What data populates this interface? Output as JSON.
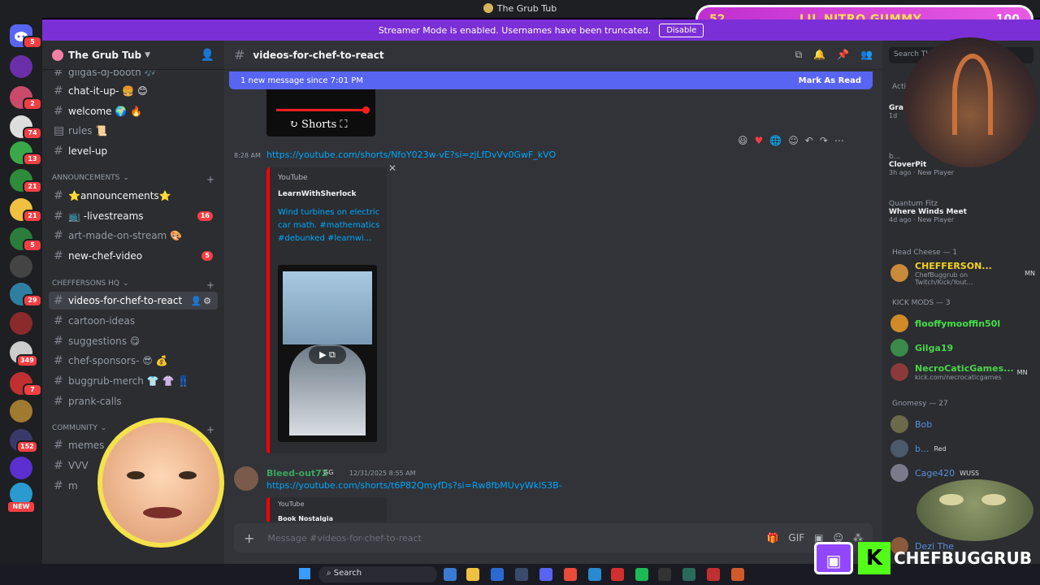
{
  "window": {
    "title": "The Grub Tub"
  },
  "streamer_banner": {
    "text": "Streamer Mode is enabled. Usernames have been truncated.",
    "button": "Disable"
  },
  "nitro_bar": {
    "left": "52",
    "title": "LIL NITRO GUMMY",
    "right": "100"
  },
  "rail": {
    "badges": [
      "5",
      "2",
      "74",
      "13",
      "21",
      "21",
      "5",
      "29",
      "349",
      "7",
      "152"
    ],
    "new_label": "NEW"
  },
  "server": {
    "name": "The Grub Tub"
  },
  "channels": {
    "top": [
      {
        "name": "gilgas-dj-booth 🎶",
        "unread": false
      },
      {
        "name": "chat-it-up- 🍔 😊",
        "unread": true
      },
      {
        "name": "welcome 🌍 🔥",
        "unread": true
      },
      {
        "name": "rules 📜",
        "unread": false
      },
      {
        "name": "level-up",
        "unread": true
      }
    ],
    "announcements_label": "Announcements",
    "announcements": [
      {
        "name": "⭐announcements⭐",
        "unread": true,
        "count": ""
      },
      {
        "name": "📺 -livestreams",
        "unread": true,
        "count": "16"
      },
      {
        "name": "art-made-on-stream 🎨",
        "unread": false,
        "count": ""
      },
      {
        "name": "new-chef-video",
        "unread": true,
        "count": "5"
      }
    ],
    "hq_label": "CHEFFERSONS HQ",
    "hq": [
      {
        "name": "videos-for-chef-to-react"
      },
      {
        "name": "cartoon-ideas"
      },
      {
        "name": "suggestions 😋"
      },
      {
        "name": "chef-sponsors- 😎 💰"
      },
      {
        "name": "buggrub-merch 👕 👚 👖"
      },
      {
        "name": "prank-calls"
      }
    ],
    "community_label": "Community",
    "community": [
      {
        "name": "memes"
      },
      {
        "name": "VVV"
      },
      {
        "name": "m"
      }
    ]
  },
  "chat": {
    "channel_name": "videos-for-chef-to-react",
    "new_message_bar": {
      "text": "1 new message since 7:01 PM",
      "action": "Mark As Read"
    },
    "shorts_preview_label": "Shorts",
    "message1": {
      "time": "8:28 AM",
      "link": "https://youtube.com/shorts/NfoY023w-vE?si=zjLfDvVv0GwF_kVO",
      "embed": {
        "provider": "YouTube",
        "author": "LearnWithSherlock",
        "title": "Wind turbines on electric car math. #mathematics #debunked #learnwi..."
      }
    },
    "message2": {
      "user": "Bleed-out72",
      "tag": "GG",
      "time": "12/31/2025 8:55 AM",
      "link": "https://youtube.com/shorts/t6P82QmyfDs?si=Rw8fbMUvyWklS3B-",
      "embed": {
        "provider": "YouTube",
        "author": "Book Nostalgia"
      }
    },
    "composer_placeholder": "Message #videos-for-chef-to-react"
  },
  "members": {
    "search_placeholder": "Search Th",
    "activity_label": "Activ",
    "activities": [
      {
        "small": "",
        "title": "Gran",
        "meta": "1d"
      },
      {
        "small": "b...",
        "title": "CloverPit",
        "meta": "3h ago · New Player"
      },
      {
        "small": "Quantum Fitz",
        "title": "Where Winds Meet",
        "meta": "4d ago · New Player"
      }
    ],
    "sections": [
      {
        "label": "Head Cheese — 1",
        "members": [
          {
            "name": "CHEFFERSON...",
            "tag": "MN",
            "sub": "ChefBuggrub on Twitch/Kick/Yout...",
            "color": "#f5d320"
          }
        ]
      },
      {
        "label": "KICK MODS — 3",
        "members": [
          {
            "name": "flooffymooffin50l",
            "tag": "",
            "sub": "",
            "color": "#45e048"
          },
          {
            "name": "Gilga19",
            "tag": "",
            "sub": "",
            "color": "#4bd44b"
          },
          {
            "name": "NecroCaticGames...",
            "tag": "MN",
            "sub": "kick.com/necrocaticgames",
            "color": "#4bd44b"
          }
        ]
      },
      {
        "label": "Gnomesy — 27",
        "members": [
          {
            "name": "Bob",
            "tag": "",
            "sub": "",
            "color": "#5a8fd8"
          },
          {
            "name": "b...",
            "tag": "Red",
            "sub": "",
            "color": "#5a8fd8"
          },
          {
            "name": "Cage420",
            "tag": "WUSS",
            "sub": "",
            "color": "#5a8fd8"
          },
          {
            "name": "Dezi The",
            "tag": "",
            "sub": "",
            "color": "#5a8fd8"
          }
        ]
      }
    ]
  },
  "taskbar": {
    "search_label": "Search"
  },
  "brand": {
    "name": "CHEFBUGGRUB",
    "kick_letter": "K"
  }
}
